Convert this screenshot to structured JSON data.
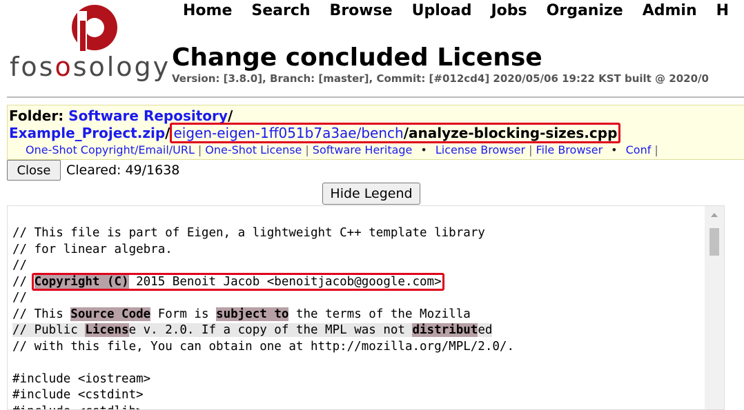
{
  "app": {
    "logo_text_prefix": "fos",
    "logo_text_suffix": "sology",
    "brand_color": "#b2121b"
  },
  "nav": {
    "items": [
      "Home",
      "Search",
      "Browse",
      "Upload",
      "Jobs",
      "Organize",
      "Admin",
      "H"
    ]
  },
  "page": {
    "title": "Change concluded License",
    "version": "Version: [3.8.0], Branch: [master], Commit: [#012cd4] 2020/05/06 19:22 KST built @ 2020/0"
  },
  "path": {
    "folder_label": "Folder",
    "folder_colon": ": ",
    "folder_name": "Software Repository",
    "sep": "/",
    "upload": "Example_Project.zip",
    "subdir": "eigen-eigen-1ff051b7a3ae/bench",
    "file": "analyze-blocking-sizes.cpp"
  },
  "links": {
    "group1": [
      "One-Shot Copyright/Email/URL",
      "One-Shot License",
      "Software Heritage"
    ],
    "group2": [
      "License Browser",
      "File Browser"
    ],
    "group3": [
      "Conf"
    ],
    "separator": "|",
    "bullet": "•"
  },
  "controls": {
    "close_label": "Close",
    "cleared": "Cleared: 49/1638",
    "legend_label": "Hide Legend"
  },
  "code": {
    "lines": {
      "l1": "// This file is part of Eigen, a lightweight C++ template library",
      "l2": "// for linear algebra.",
      "l3": "//",
      "l4_prefix": "// ",
      "l4_hl": "Copyright (C)",
      "l4_rest": " 2015 Benoit Jacob <benoitjacob@google.com>",
      "l5": "//",
      "l6_a": "// This ",
      "l6_hl1": "Source Code",
      "l6_b": " Form is ",
      "l6_hl2": "subject to",
      "l6_c": " the terms of the Mozilla",
      "l7_a": "// Public ",
      "l7_hl1": "Licens",
      "l7_b": "e v. 2.0. If a copy of the MPL was not ",
      "l7_hl2": "distribut",
      "l7_c": "ed",
      "l8": "// with this file, You can obtain one at http://mozilla.org/MPL/2.0/.",
      "l9": "",
      "l10": "#include <iostream>",
      "l11": "#include <cstdint>",
      "l12": "#include <cstdlib>"
    },
    "highlight_color": "#b7a0a6",
    "annotation_color": "#e0001b"
  }
}
